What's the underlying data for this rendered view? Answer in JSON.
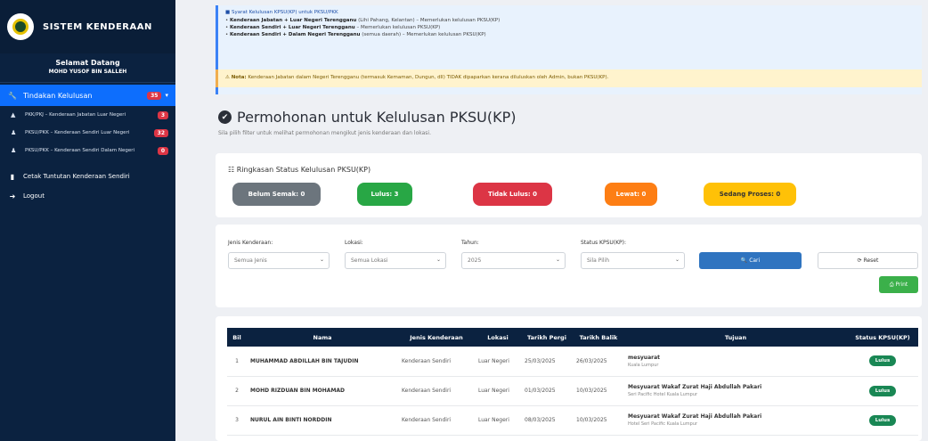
{
  "sidebar": {
    "brand": "SISTEM KENDERAAN",
    "welcome": "Selamat Datang",
    "user": "MOHD YUSOF BIN SALLEH",
    "active_item": {
      "label": "Tindakan Kelulusan",
      "badge": "35"
    },
    "sub_items": [
      {
        "label": "PKK/PKJ – Kenderaan Jabatan Luar Negeri",
        "badge": "3"
      },
      {
        "label": "PKSU/PKK – Kenderaan Sendiri Luar Negeri",
        "badge": "32"
      },
      {
        "label": "PKSU/PKK – Kenderaan Sendiri Dalam Negeri",
        "badge": "0"
      }
    ],
    "items": [
      {
        "label": "Cetak Tuntutan Kenderaan Sendiri"
      },
      {
        "label": "Logout"
      }
    ]
  },
  "info": {
    "title": "Syarat Kelulusan KPSU(KP) untuk PKSU/PKK",
    "lines": [
      {
        "bold": "Kenderaan Jabatan + Luar Negeri Terengganu",
        "rest": "(Lihi Pahang, Kelantan) – Memerlukan kelulusan PKSU(KP)"
      },
      {
        "bold": "Kenderaan Sendiri + Luar Negeri Terengganu",
        "rest": "– Memerlukan kelulusan PKSU(KP)"
      },
      {
        "bold": "Kenderaan Sendiri + Dalam Negeri Terengganu",
        "rest": "(semua daerah) – Memerlukan kelulusan PKSU(KP)"
      }
    ],
    "note_label": "Nota:",
    "note_text": "Kenderaan Jabatan dalam Negeri Terengganu (termasuk Kemaman, Dungun, dll) TIDAK dipaparkan kerana diluluskan oleh Admin, bukan PKSU(KP)."
  },
  "page": {
    "title": "Permohonan untuk Kelulusan PKSU(KP)",
    "subtitle": "Sila pilih filter untuk melihat permohonan mengikut jenis kenderaan dan lokasi."
  },
  "summary": {
    "title": "Ringkasan Status Kelulusan PKSU(KP)",
    "pills": [
      {
        "label": "Belum Semak: 0",
        "color": "#6c757d"
      },
      {
        "label": "Lulus: 3",
        "color": "#28a745"
      },
      {
        "label": "Tidak Lulus: 0",
        "color": "#dc3545"
      },
      {
        "label": "Lewat: 0",
        "color": "#fd7e14"
      },
      {
        "label": "Sedang Proses: 0",
        "color": "#ffc107"
      }
    ]
  },
  "filter": {
    "labels": [
      "Jenis Kenderaan:",
      "Lokasi:",
      "Tahun:",
      "Status KPSU(KP):"
    ],
    "values": [
      "Semua Jenis",
      "Semua Lokasi",
      "2025",
      "Sila Pilih"
    ],
    "search_label": "Cari",
    "reset_label": "Reset",
    "print_label": "Print"
  },
  "table": {
    "headers": [
      "Bil",
      "Nama",
      "Jenis Kenderaan",
      "Lokasi",
      "Tarikh Pergi",
      "Tarikh Balik",
      "Tujuan",
      "Status KPSU(KP)"
    ],
    "rows": [
      {
        "bil": "1",
        "nama": "MUHAMMAD ABDILLAH BIN TAJUDIN",
        "jenis": "Kenderaan Sendiri",
        "lokasi": "Luar Negeri",
        "pergi": "25/03/2025",
        "balik": "26/03/2025",
        "tujuan": "mesyuarat",
        "tujuan_sub": "Kuala Lumpur",
        "status": "Lulus"
      },
      {
        "bil": "2",
        "nama": "MOHD RIZDUAN BIN MOHAMAD",
        "jenis": "Kenderaan Sendiri",
        "lokasi": "Luar Negeri",
        "pergi": "01/03/2025",
        "balik": "10/03/2025",
        "tujuan": "Mesyuarat Wakaf Zurat Haji Abdullah Pakari",
        "tujuan_sub": "Seri Pacific Hotel Kuala Lumpur",
        "status": "Lulus"
      },
      {
        "bil": "3",
        "nama": "NURUL AIN BINTI NORDDIN",
        "jenis": "Kenderaan Sendiri",
        "lokasi": "Luar Negeri",
        "pergi": "08/03/2025",
        "balik": "10/03/2025",
        "tujuan": "Mesyuarat Wakaf Zurat Haji Abdullah Pakari",
        "tujuan_sub": "Hotel Seri Pacific Kuala Lumpur",
        "status": "Lulus"
      }
    ]
  },
  "colors": {
    "sidebar": "#0b2240",
    "accent": "#0d6efd",
    "status_ok": "#198754"
  }
}
